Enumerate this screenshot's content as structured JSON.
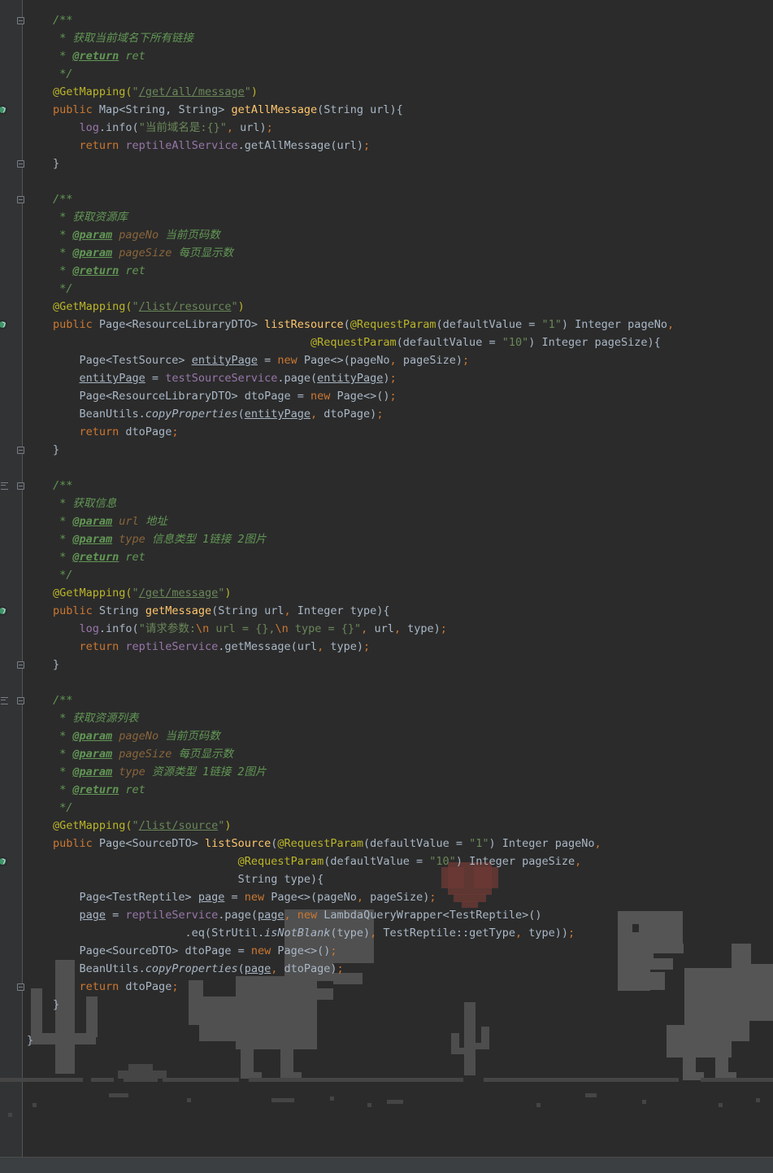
{
  "editor": {
    "language": "java",
    "lines": [
      {
        "segs": [
          [
            "cm",
            "/**"
          ]
        ]
      },
      {
        "segs": [
          [
            "cm",
            " * 获取当前域名下所有链接"
          ]
        ]
      },
      {
        "segs": [
          [
            "cm",
            " * "
          ],
          [
            "tag",
            "@return"
          ],
          [
            "cm",
            " ret"
          ]
        ]
      },
      {
        "segs": [
          [
            "cm",
            " */"
          ]
        ]
      },
      {
        "segs": [
          [
            "a",
            "@GetMapping("
          ],
          [
            "s",
            "\""
          ],
          [
            "su",
            "/get/all/message"
          ],
          [
            "s",
            "\""
          ],
          [
            "a",
            ")"
          ]
        ]
      },
      {
        "segs": [
          [
            "k",
            "public "
          ],
          [
            "p",
            "Map<String, String> "
          ],
          [
            "fn",
            "getAllMessage"
          ],
          [
            "p",
            "(String url){"
          ]
        ]
      },
      {
        "segs": [
          [
            "p",
            "    "
          ],
          [
            "f",
            "log"
          ],
          [
            "p",
            ".info("
          ],
          [
            "s",
            "\"当前域名是:{}\""
          ],
          [
            "k",
            ", "
          ],
          [
            "p",
            "url)"
          ],
          [
            "k",
            ";"
          ]
        ]
      },
      {
        "segs": [
          [
            "p",
            "    "
          ],
          [
            "k",
            "return "
          ],
          [
            "f",
            "reptileAllService"
          ],
          [
            "p",
            ".getAllMessage(url)"
          ],
          [
            "k",
            ";"
          ]
        ]
      },
      {
        "segs": [
          [
            "p",
            "}"
          ]
        ]
      },
      {
        "segs": []
      },
      {
        "segs": [
          [
            "cm",
            "/**"
          ]
        ]
      },
      {
        "segs": [
          [
            "cm",
            " * 获取资源库"
          ]
        ]
      },
      {
        "segs": [
          [
            "cm",
            " * "
          ],
          [
            "tag",
            "@param"
          ],
          [
            "pn",
            " pageNo"
          ],
          [
            "cm",
            " 当前页码数"
          ]
        ]
      },
      {
        "segs": [
          [
            "cm",
            " * "
          ],
          [
            "tag",
            "@param"
          ],
          [
            "pn",
            " pageSize"
          ],
          [
            "cm",
            " 每页显示数"
          ]
        ]
      },
      {
        "segs": [
          [
            "cm",
            " * "
          ],
          [
            "tag",
            "@return"
          ],
          [
            "cm",
            " ret"
          ]
        ]
      },
      {
        "segs": [
          [
            "cm",
            " */"
          ]
        ]
      },
      {
        "segs": [
          [
            "a",
            "@GetMapping("
          ],
          [
            "s",
            "\""
          ],
          [
            "su",
            "/list/resource"
          ],
          [
            "s",
            "\""
          ],
          [
            "a",
            ")"
          ]
        ]
      },
      {
        "segs": [
          [
            "k",
            "public "
          ],
          [
            "p",
            "Page<ResourceLibraryDTO> "
          ],
          [
            "fn",
            "listResource"
          ],
          [
            "p",
            "("
          ],
          [
            "a",
            "@RequestParam"
          ],
          [
            "p",
            "(defaultValue = "
          ],
          [
            "s",
            "\"1\""
          ],
          [
            "p",
            ") Integer pageNo"
          ],
          [
            "k",
            ","
          ]
        ]
      },
      {
        "segs": [
          [
            "p",
            "                                       "
          ],
          [
            "a",
            "@RequestParam"
          ],
          [
            "p",
            "(defaultValue = "
          ],
          [
            "s",
            "\"10\""
          ],
          [
            "p",
            ") Integer pageSize){"
          ]
        ]
      },
      {
        "segs": [
          [
            "p",
            "    Page<TestSource> "
          ],
          [
            "pu",
            "entityPage"
          ],
          [
            "p",
            " = "
          ],
          [
            "k",
            "new "
          ],
          [
            "p",
            "Page<>(pageNo"
          ],
          [
            "k",
            ", "
          ],
          [
            "p",
            "pageSize)"
          ],
          [
            "k",
            ";"
          ]
        ]
      },
      {
        "segs": [
          [
            "p",
            "    "
          ],
          [
            "pu",
            "entityPage"
          ],
          [
            "p",
            " = "
          ],
          [
            "f",
            "testSourceService"
          ],
          [
            "p",
            ".page("
          ],
          [
            "pu",
            "entityPage"
          ],
          [
            "p",
            ")"
          ],
          [
            "k",
            ";"
          ]
        ]
      },
      {
        "segs": [
          [
            "p",
            "    Page<ResourceLibraryDTO> dtoPage = "
          ],
          [
            "k",
            "new "
          ],
          [
            "p",
            "Page<>()"
          ],
          [
            "k",
            ";"
          ]
        ]
      },
      {
        "segs": [
          [
            "p",
            "    BeanUtils."
          ],
          [
            "pi",
            "copyProperties"
          ],
          [
            "p",
            "("
          ],
          [
            "pu",
            "entityPage"
          ],
          [
            "k",
            ", "
          ],
          [
            "p",
            "dtoPage)"
          ],
          [
            "k",
            ";"
          ]
        ]
      },
      {
        "segs": [
          [
            "p",
            "    "
          ],
          [
            "k",
            "return "
          ],
          [
            "p",
            "dtoPage"
          ],
          [
            "k",
            ";"
          ]
        ]
      },
      {
        "segs": [
          [
            "p",
            "}"
          ]
        ]
      },
      {
        "segs": []
      },
      {
        "segs": [
          [
            "cm",
            "/**"
          ]
        ]
      },
      {
        "segs": [
          [
            "cm",
            " * 获取信息"
          ]
        ]
      },
      {
        "segs": [
          [
            "cm",
            " * "
          ],
          [
            "tag",
            "@param"
          ],
          [
            "pn",
            " url"
          ],
          [
            "cm",
            " 地址"
          ]
        ]
      },
      {
        "segs": [
          [
            "cm",
            " * "
          ],
          [
            "tag",
            "@param"
          ],
          [
            "pn",
            " type"
          ],
          [
            "cm",
            " 信息类型 1链接 2图片"
          ]
        ]
      },
      {
        "segs": [
          [
            "cm",
            " * "
          ],
          [
            "tag",
            "@return"
          ],
          [
            "cm",
            " ret"
          ]
        ]
      },
      {
        "segs": [
          [
            "cm",
            " */"
          ]
        ]
      },
      {
        "segs": [
          [
            "a",
            "@GetMapping("
          ],
          [
            "s",
            "\""
          ],
          [
            "su",
            "/get/message"
          ],
          [
            "s",
            "\""
          ],
          [
            "a",
            ")"
          ]
        ]
      },
      {
        "segs": [
          [
            "k",
            "public "
          ],
          [
            "p",
            "String "
          ],
          [
            "fn",
            "getMessage"
          ],
          [
            "p",
            "(String url"
          ],
          [
            "k",
            ", "
          ],
          [
            "p",
            "Integer type){"
          ]
        ]
      },
      {
        "segs": [
          [
            "p",
            "    "
          ],
          [
            "f",
            "log"
          ],
          [
            "p",
            ".info("
          ],
          [
            "s",
            "\"请求参数:"
          ],
          [
            "k",
            "\\n"
          ],
          [
            "s",
            " url = {},"
          ],
          [
            "k",
            "\\n"
          ],
          [
            "s",
            " type = {}\""
          ],
          [
            "k",
            ", "
          ],
          [
            "p",
            "url"
          ],
          [
            "k",
            ", "
          ],
          [
            "p",
            "type)"
          ],
          [
            "k",
            ";"
          ]
        ]
      },
      {
        "segs": [
          [
            "p",
            "    "
          ],
          [
            "k",
            "return "
          ],
          [
            "f",
            "reptileService"
          ],
          [
            "p",
            ".getMessage(url"
          ],
          [
            "k",
            ", "
          ],
          [
            "p",
            "type)"
          ],
          [
            "k",
            ";"
          ]
        ]
      },
      {
        "segs": [
          [
            "p",
            "}"
          ]
        ]
      },
      {
        "segs": []
      },
      {
        "segs": [
          [
            "cm",
            "/**"
          ]
        ]
      },
      {
        "segs": [
          [
            "cm",
            " * 获取资源列表"
          ]
        ]
      },
      {
        "segs": [
          [
            "cm",
            " * "
          ],
          [
            "tag",
            "@param"
          ],
          [
            "pn",
            " pageNo"
          ],
          [
            "cm",
            " 当前页码数"
          ]
        ]
      },
      {
        "segs": [
          [
            "cm",
            " * "
          ],
          [
            "tag",
            "@param"
          ],
          [
            "pn",
            " pageSize"
          ],
          [
            "cm",
            " 每页显示数"
          ]
        ]
      },
      {
        "segs": [
          [
            "cm",
            " * "
          ],
          [
            "tag",
            "@param"
          ],
          [
            "pn",
            " type"
          ],
          [
            "cm",
            " 资源类型 1链接 2图片"
          ]
        ]
      },
      {
        "segs": [
          [
            "cm",
            " * "
          ],
          [
            "tag",
            "@return"
          ],
          [
            "cm",
            " ret"
          ]
        ]
      },
      {
        "segs": [
          [
            "cm",
            " */"
          ]
        ]
      },
      {
        "segs": [
          [
            "a",
            "@GetMapping("
          ],
          [
            "s",
            "\""
          ],
          [
            "su",
            "/list/source"
          ],
          [
            "s",
            "\""
          ],
          [
            "a",
            ")"
          ]
        ]
      },
      {
        "segs": [
          [
            "k",
            "public "
          ],
          [
            "p",
            "Page<SourceDTO> "
          ],
          [
            "fn",
            "listSource"
          ],
          [
            "p",
            "("
          ],
          [
            "a",
            "@RequestParam"
          ],
          [
            "p",
            "(defaultValue = "
          ],
          [
            "s",
            "\"1\""
          ],
          [
            "p",
            ") Integer pageNo"
          ],
          [
            "k",
            ","
          ]
        ]
      },
      {
        "segs": [
          [
            "p",
            "                            "
          ],
          [
            "a",
            "@RequestParam"
          ],
          [
            "p",
            "(defaultValue = "
          ],
          [
            "s",
            "\"10\""
          ],
          [
            "p",
            ") Integer pageSize"
          ],
          [
            "k",
            ","
          ]
        ]
      },
      {
        "segs": [
          [
            "p",
            "                            String type){"
          ]
        ]
      },
      {
        "segs": [
          [
            "p",
            "    Page<TestReptile> "
          ],
          [
            "pu",
            "page"
          ],
          [
            "p",
            " = "
          ],
          [
            "k",
            "new "
          ],
          [
            "p",
            "Page<>(pageNo"
          ],
          [
            "k",
            ", "
          ],
          [
            "p",
            "pageSize)"
          ],
          [
            "k",
            ";"
          ]
        ]
      },
      {
        "segs": [
          [
            "p",
            "    "
          ],
          [
            "pu",
            "page"
          ],
          [
            "p",
            " = "
          ],
          [
            "f",
            "reptileService"
          ],
          [
            "p",
            ".page("
          ],
          [
            "pu",
            "page"
          ],
          [
            "k",
            ", new "
          ],
          [
            "p",
            "LambdaQueryWrapper<TestReptile>()"
          ]
        ]
      },
      {
        "segs": [
          [
            "p",
            "                    .eq(StrUtil."
          ],
          [
            "pi",
            "isNotBlank"
          ],
          [
            "p",
            "(type)"
          ],
          [
            "k",
            ", "
          ],
          [
            "p",
            "TestReptile::getType"
          ],
          [
            "k",
            ", "
          ],
          [
            "p",
            "type))"
          ],
          [
            "k",
            ";"
          ]
        ]
      },
      {
        "segs": [
          [
            "p",
            "    Page<SourceDTO> dtoPage = "
          ],
          [
            "k",
            "new "
          ],
          [
            "p",
            "Page<>()"
          ],
          [
            "k",
            ";"
          ]
        ]
      },
      {
        "segs": [
          [
            "p",
            "    BeanUtils."
          ],
          [
            "pi",
            "copyProperties"
          ],
          [
            "p",
            "("
          ],
          [
            "pu",
            "page"
          ],
          [
            "k",
            ", "
          ],
          [
            "p",
            "dtoPage)"
          ],
          [
            "k",
            ";"
          ]
        ]
      },
      {
        "segs": [
          [
            "p",
            "    "
          ],
          [
            "k",
            "return "
          ],
          [
            "p",
            "dtoPage"
          ],
          [
            "k",
            ";"
          ]
        ]
      },
      {
        "segs": [
          [
            "p",
            "}"
          ]
        ]
      },
      {
        "segs": []
      },
      {
        "segs": [
          [
            "p",
            "}"
          ]
        ]
      }
    ]
  },
  "gutter": {
    "fold_markers": [
      0,
      8,
      10,
      24,
      26,
      36,
      38,
      54
    ],
    "mapping_icons": [
      5,
      17,
      33,
      47
    ],
    "doc_icons": [
      26,
      38
    ]
  },
  "colors": {
    "background": "#2b2b2b",
    "keyword": "#cc7832",
    "annotation": "#bbb529",
    "string": "#6a8759",
    "comment": "#629755",
    "method": "#ffc66d",
    "field": "#9876aa",
    "plain": "#a9b7c6"
  }
}
